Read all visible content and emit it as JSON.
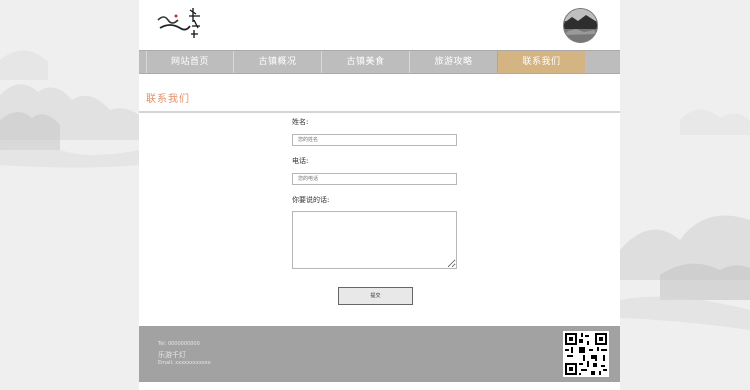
{
  "nav": {
    "items": [
      {
        "label": "网站首页"
      },
      {
        "label": "古镇概况"
      },
      {
        "label": "古镇美食"
      },
      {
        "label": "旅游攻略"
      },
      {
        "label": "联系我们"
      }
    ],
    "active_index": 4
  },
  "page": {
    "title": "联系我们"
  },
  "form": {
    "name_label": "姓名:",
    "name_placeholder": "您的姓名",
    "phone_label": "电话:",
    "phone_placeholder": "您的电话",
    "message_label": "你要说的话:",
    "submit_label": "提交"
  },
  "footer": {
    "phone_line": "Tel: 0000000000",
    "brand_line": "乐游千灯",
    "email_line": "Email: xxxxxxxxxxxx"
  },
  "colors": {
    "accent_title": "#e08f6a",
    "nav_active": "#d4b482",
    "nav_bg": "#bdbdbd",
    "footer_bg": "#a2a2a2"
  },
  "icons": {
    "logo": "ink-brush-logo",
    "avatar": "circular-photo-avatar",
    "qr": "qr-code"
  }
}
